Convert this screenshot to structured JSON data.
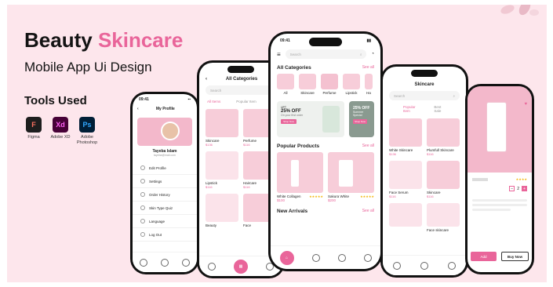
{
  "hero": {
    "title_main": "Beauty",
    "title_accent": "Skincare",
    "subtitle": "Mobile App Ui Design",
    "tools_heading": "Tools Used",
    "tools": [
      {
        "abbr": "F",
        "label": "Figma",
        "bg": "#1e1e1e",
        "fg": "#ff7262"
      },
      {
        "abbr": "Xd",
        "label": "Adobe XD",
        "bg": "#470137",
        "fg": "#ff61f6"
      },
      {
        "abbr": "Ps",
        "label": "Adobe Photoshop",
        "bg": "#001e36",
        "fg": "#31a8ff"
      }
    ]
  },
  "colors": {
    "accent": "#e9659a",
    "background": "#fde6ec",
    "product_pink": "#f7cdd9"
  },
  "profile_screen": {
    "time": "09:41",
    "title": "My Profile",
    "name": "Tayeba Islam",
    "email": "tayeba@mail.com",
    "menu": [
      "Edit Profile",
      "Settings",
      "Order History",
      "Skin Type Quiz",
      "Language",
      "Log Out"
    ]
  },
  "categories_screen": {
    "title": "All Categories",
    "search_placeholder": "Search",
    "tabs": [
      "All Items",
      "Popular Item"
    ],
    "products": [
      {
        "name": "Skincare",
        "price": "$136"
      },
      {
        "name": "Perfume",
        "price": "$116"
      },
      {
        "name": "Lipstick",
        "price": "$116"
      },
      {
        "name": "Haircare",
        "price": "$116"
      },
      {
        "name": "Beauty",
        "price": ""
      },
      {
        "name": "Face",
        "price": ""
      }
    ]
  },
  "home_screen": {
    "time": "09:41",
    "search_placeholder": "Search",
    "all_categories": "All Categories",
    "see_all": "See all",
    "categories": [
      "All",
      "Skincare",
      "Perfume",
      "Lipstick",
      "Ha"
    ],
    "banner1": {
      "line1": "UPT",
      "line2": "25% OFF",
      "line3": "On your first order",
      "cta": "Shop Now"
    },
    "banner2": {
      "line1": "25% OFF",
      "line2": "Summer Special",
      "cta": "Shop Now"
    },
    "popular_products": "Popular Products",
    "products": [
      {
        "name": "White Collagen",
        "price": "$100"
      },
      {
        "name": "Sakura White",
        "price": "$200"
      }
    ],
    "new_arrivals": "New Arrivals"
  },
  "skincare_screen": {
    "title": "Skincare",
    "search_placeholder": "Search",
    "tabs": [
      "Popular Item",
      "Best Sale"
    ],
    "products": [
      {
        "name": "White Skincare",
        "price": "$136"
      },
      {
        "name": "Plumfull Skincare",
        "price": "$116"
      },
      {
        "name": "Face Serum",
        "price": "$116"
      },
      {
        "name": "Skincare",
        "price": "$116"
      },
      {
        "name": "",
        "price": ""
      },
      {
        "name": "Face skincare",
        "price": ""
      }
    ]
  },
  "detail_screen": {
    "quantity": "2",
    "cta": "Buy Now",
    "add_label": "Add"
  }
}
